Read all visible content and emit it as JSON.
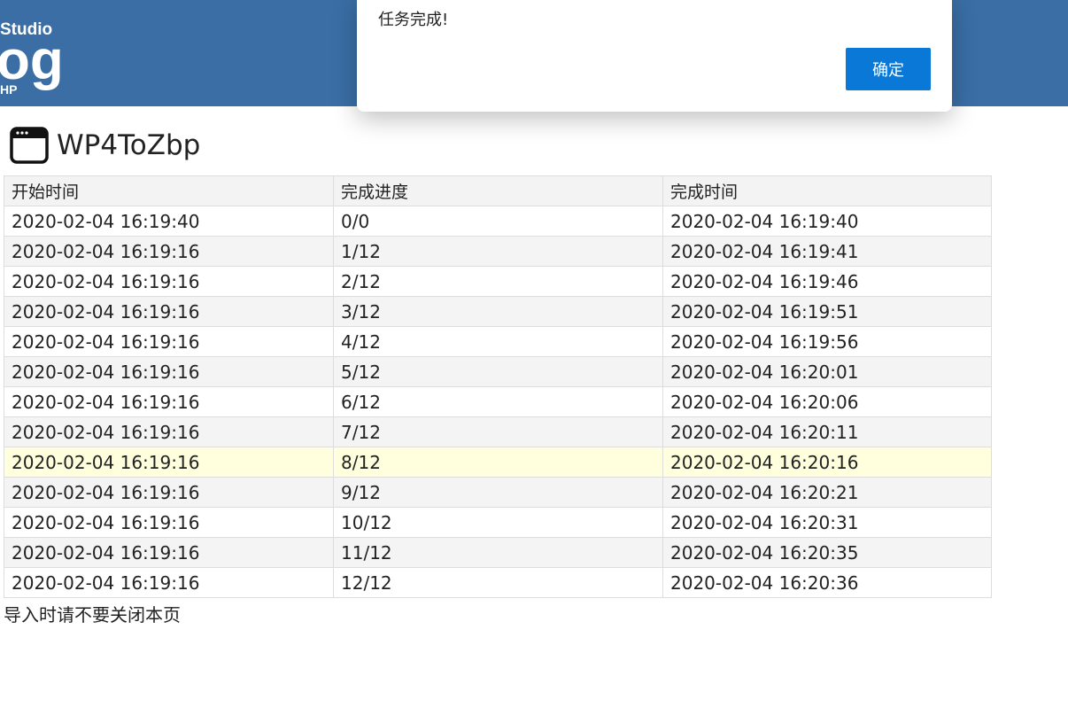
{
  "header": {
    "logo_line1": "Studio",
    "logo_line2": "og",
    "logo_line3": "HP",
    "background_color": "#3a6ea5"
  },
  "app": {
    "title": "WP4ToZbp",
    "icon": "window-icon"
  },
  "table": {
    "columns": [
      "开始时间",
      "完成进度",
      "完成时间"
    ],
    "rows": [
      [
        "2020-02-04 16:19:40",
        "0/0",
        "2020-02-04 16:19:40"
      ],
      [
        "2020-02-04 16:19:16",
        "1/12",
        "2020-02-04 16:19:41"
      ],
      [
        "2020-02-04 16:19:16",
        "2/12",
        "2020-02-04 16:19:46"
      ],
      [
        "2020-02-04 16:19:16",
        "3/12",
        "2020-02-04 16:19:51"
      ],
      [
        "2020-02-04 16:19:16",
        "4/12",
        "2020-02-04 16:19:56"
      ],
      [
        "2020-02-04 16:19:16",
        "5/12",
        "2020-02-04 16:20:01"
      ],
      [
        "2020-02-04 16:19:16",
        "6/12",
        "2020-02-04 16:20:06"
      ],
      [
        "2020-02-04 16:19:16",
        "7/12",
        "2020-02-04 16:20:11"
      ],
      [
        "2020-02-04 16:19:16",
        "8/12",
        "2020-02-04 16:20:16"
      ],
      [
        "2020-02-04 16:19:16",
        "9/12",
        "2020-02-04 16:20:21"
      ],
      [
        "2020-02-04 16:19:16",
        "10/12",
        "2020-02-04 16:20:31"
      ],
      [
        "2020-02-04 16:19:16",
        "11/12",
        "2020-02-04 16:20:35"
      ],
      [
        "2020-02-04 16:19:16",
        "12/12",
        "2020-02-04 16:20:36"
      ]
    ],
    "highlighted_row": 8,
    "highlight_color": "#ffffdd"
  },
  "note": "导入时请不要关闭本页",
  "dialog": {
    "message": "任务完成!",
    "ok_label": "确定",
    "ok_color": "#0a78d7"
  }
}
